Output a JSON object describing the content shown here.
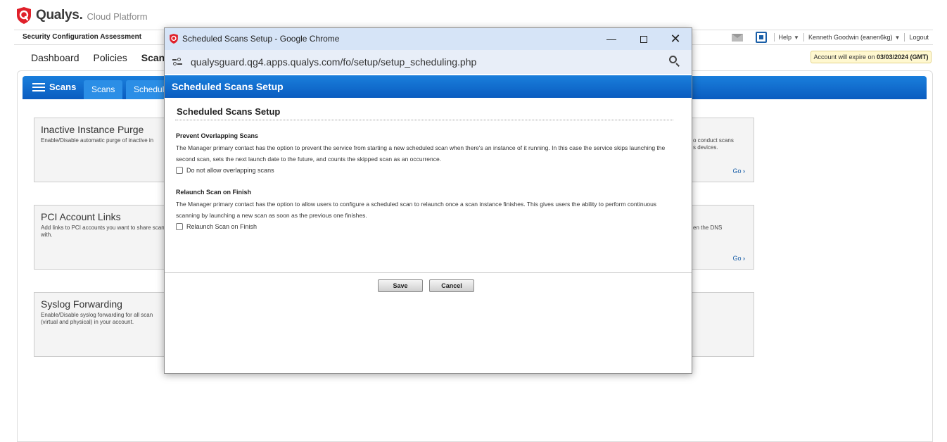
{
  "brand": {
    "name": "Qualys.",
    "sub": "Cloud Platform"
  },
  "module_bar": {
    "module": "Security Configuration Assessment",
    "help": "Help",
    "user": "Kenneth Goodwin (eanen6kg)",
    "logout": "Logout"
  },
  "main_nav": [
    "Dashboard",
    "Policies",
    "Scans"
  ],
  "expire": {
    "prefix": "Account will expire on ",
    "date": "03/03/2024 (GMT)"
  },
  "panel": {
    "title": "Scans",
    "tabs": [
      "Scans",
      "Scheduled"
    ]
  },
  "cards": [
    {
      "title": "Inactive Instance Purge",
      "desc": "Enable/Disable automatic purge of inactive in",
      "right": "o conduct scans\ns devices.",
      "go": "Go"
    },
    {
      "title": "PCI Account Links",
      "desc": "Add links to PCI accounts you want to share scans with.",
      "right": "en the DNS",
      "go": "Go"
    },
    {
      "title": "Syslog Forwarding",
      "desc": "Enable/Disable syslog forwarding for all scan (virtual and physical) in your account.",
      "right": "",
      "go": ""
    }
  ],
  "popup": {
    "window_title": "Scheduled Scans Setup - Google Chrome",
    "url": "qualysguard.qg4.apps.qualys.com/fo/setup/setup_scheduling.php",
    "header": "Scheduled Scans Setup",
    "section_title": "Scheduled Scans Setup",
    "prevent": {
      "title": "Prevent Overlapping Scans",
      "text": "The Manager primary contact has the option to prevent the service from starting a new scheduled scan when there's an instance of it running. In this case the service skips launching the second scan, sets the next launch date to the future, and counts the skipped scan as an occurrence.",
      "checkbox": "Do not allow overlapping scans",
      "checked": false
    },
    "relaunch": {
      "title": "Relaunch Scan on Finish",
      "text": "The Manager primary contact has the option to allow users to configure a scheduled scan to relaunch once a scan instance finishes. This gives users the ability to perform continuous scanning by launching a new scan as soon as the previous one finishes.",
      "checkbox": "Relaunch Scan on Finish",
      "checked": false
    },
    "save": "Save",
    "cancel": "Cancel"
  },
  "colors": {
    "accent": "#0a5cc0",
    "titlebar": "#d6e4f7",
    "brand_red": "#e0202a"
  }
}
